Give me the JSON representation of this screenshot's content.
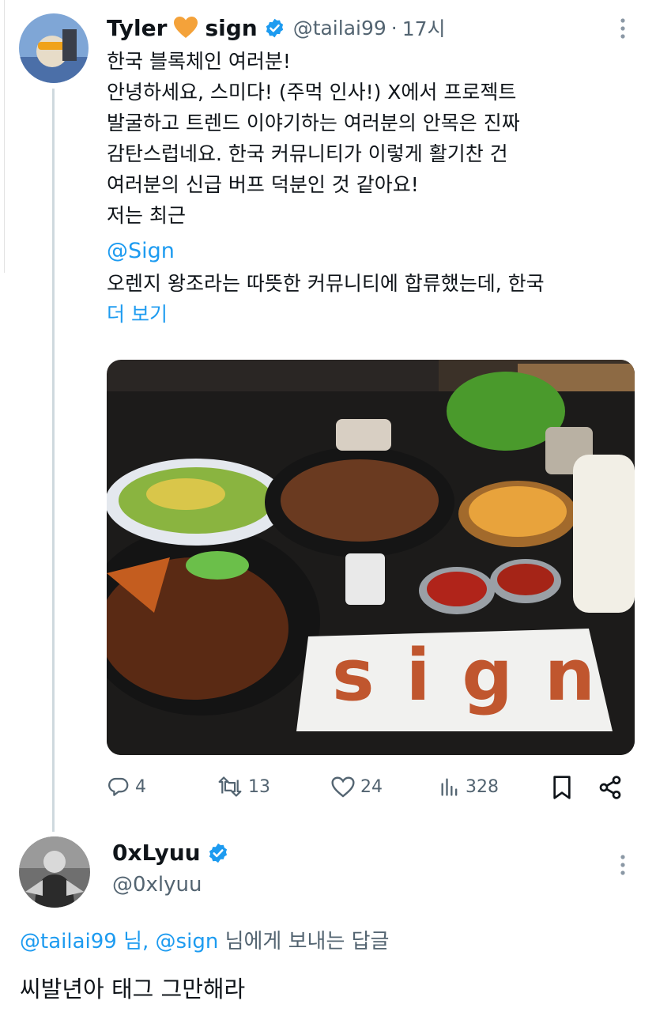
{
  "tweet": {
    "author_name_1": "Tyler",
    "author_name_2": "sign",
    "handle": "@tailai99",
    "separator": "·",
    "time": "17시",
    "body_lines": [
      "한국 블록체인 여러분!",
      "안녕하세요, 스미다! (주먹 인사!) X에서 프로젝트",
      "발굴하고 트렌드 이야기하는 여러분의 안목은 진짜",
      "감탄스럽네요. 한국 커뮤니티가 이렇게 활기찬 건",
      "여러분의 신급 버프 덕분인 것 같아요!",
      "저는 최근"
    ],
    "mention": "@Sign",
    "body_after": " 오렌지 왕조라는 따뜻한 커뮤니티에 합류했는데, 한국",
    "show_more": "더 보기",
    "photo_text": "sign",
    "actions": {
      "replies": "4",
      "reposts": "13",
      "likes": "24",
      "views": "328"
    }
  },
  "reply": {
    "author_name": "0xLyuu",
    "handle": "@0xlyuu",
    "replying_to": {
      "mention1": "@tailai99",
      "word1": "님,",
      "mention2": "@sign",
      "suffix": "님에게 보내는 답글"
    },
    "text": "씨발년아 태그 그만해라"
  },
  "colors": {
    "accent": "#1d9bf0",
    "muted": "#536471",
    "thread_line": "#cfd9de"
  }
}
